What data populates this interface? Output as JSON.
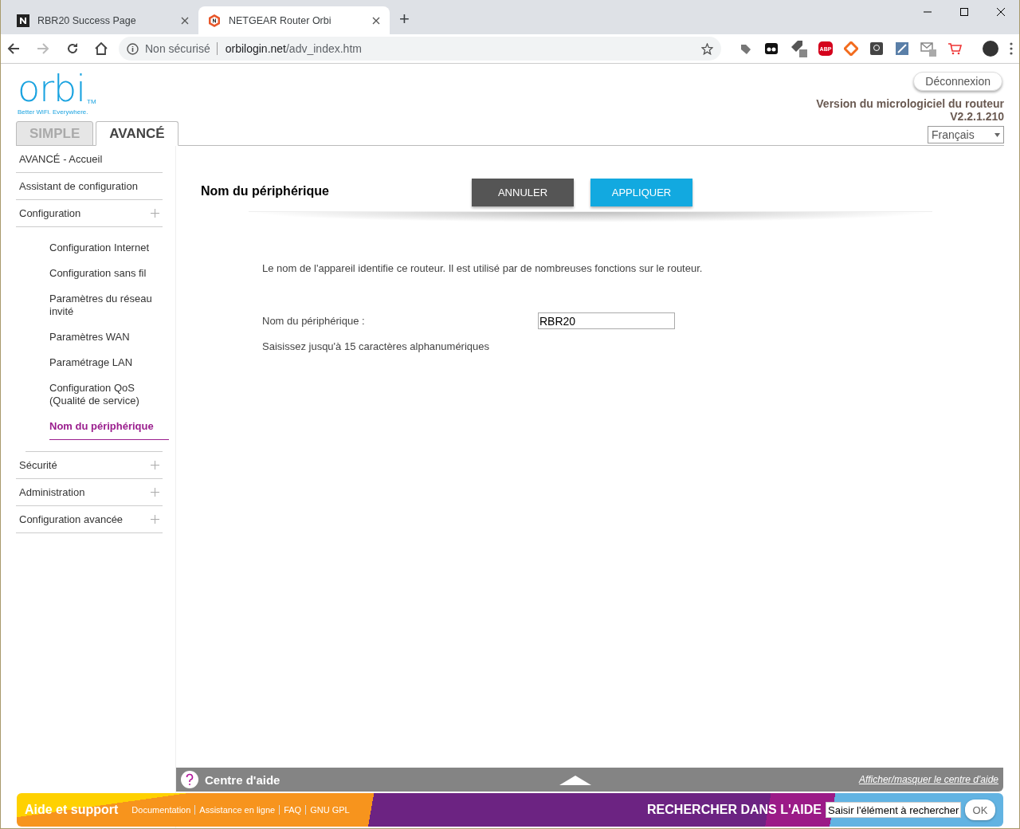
{
  "browser": {
    "tabs": [
      {
        "title": "RBR20 Success Page",
        "selected": false
      },
      {
        "title": "NETGEAR Router Orbi",
        "selected": true
      }
    ],
    "new_tab": "+",
    "address": {
      "security": "Non sécurisé",
      "host": "orbilogin.net",
      "path": "/adv_index.htm"
    },
    "adblock_label": "ABP"
  },
  "header": {
    "logo": "orbi",
    "logo_mark": "TM",
    "tagline": "Better WiFi. Everywhere.",
    "logout": "Déconnexion",
    "firmware_label": "Version du micrologiciel du routeur",
    "firmware_version": "V2.2.1.210",
    "language": "Français"
  },
  "mode_tabs": [
    {
      "label": "SIMPLE",
      "selected": false
    },
    {
      "label": "AVANCÉ",
      "selected": true
    }
  ],
  "sidebar": [
    {
      "label": "AVANCÉ - Accueil",
      "kind": "link"
    },
    {
      "label": "Assistant de configuration",
      "kind": "link"
    },
    {
      "label": "Configuration",
      "kind": "group",
      "children": [
        {
          "label": "Configuration Internet",
          "selected": false
        },
        {
          "label": "Configuration sans fil",
          "selected": false
        },
        {
          "label": "Paramètres du réseau invité",
          "selected": false
        },
        {
          "label": "Paramètres WAN",
          "selected": false
        },
        {
          "label": "Paramétrage LAN",
          "selected": false
        },
        {
          "label": "Configuration QoS (Qualité de service)",
          "selected": false
        },
        {
          "label": "Nom du périphérique",
          "selected": true
        }
      ]
    },
    {
      "label": "Sécurité",
      "kind": "group"
    },
    {
      "label": "Administration",
      "kind": "group"
    },
    {
      "label": "Configuration avancée",
      "kind": "group"
    }
  ],
  "main": {
    "title": "Nom du périphérique",
    "buttons": [
      {
        "label": "ANNULER",
        "kind": "cancel"
      },
      {
        "label": "APPLIQUER",
        "kind": "apply"
      }
    ],
    "description": "Le nom de l'appareil identifie ce routeur. Il est utilisé par de nombreuses fonctions sur le routeur.",
    "field": {
      "label": "Nom du périphérique :",
      "value": "RBR20"
    },
    "hint": "Saisissez jusqu'à 15 caractères alphanumériques"
  },
  "help_bar": {
    "title": "Centre d'aide",
    "toggle_link": "Afficher/masquer le centre d'aide"
  },
  "footer": {
    "title": "Aide et support",
    "links": [
      "Documentation",
      "Assistance en ligne",
      "FAQ",
      "GNU GPL"
    ],
    "search_label": "RECHERCHER DANS L'AIDE",
    "search_value": "Saisir l'élément à rechercher",
    "ok": "OK"
  }
}
